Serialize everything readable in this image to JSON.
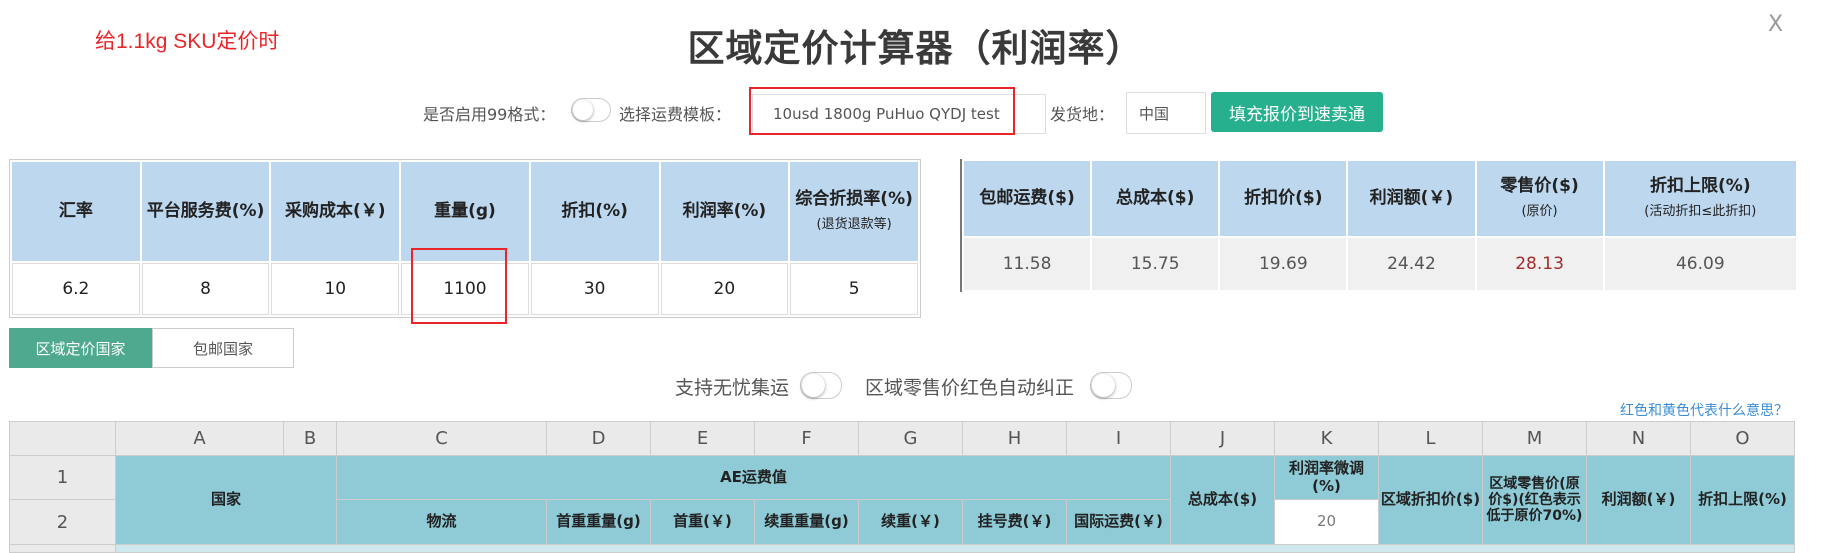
{
  "annotation": "给1.1kg SKU定价时",
  "title": "区域定价计算器（利润率）",
  "close_label": "X",
  "controls": {
    "format99_label": "是否启用99格式：",
    "template_label": "选择运费模板：",
    "template_value": "10usd 1800g PuHuo QYDJ test",
    "ship_from_label": "发货地：",
    "ship_from_value": "中国",
    "fill_button": "填充报价到速卖通"
  },
  "input_table": {
    "headers": [
      {
        "main": "汇率",
        "sub": ""
      },
      {
        "main": "平台服务费(%)",
        "sub": ""
      },
      {
        "main": "采购成本(￥)",
        "sub": ""
      },
      {
        "main": "重量(g)",
        "sub": ""
      },
      {
        "main": "折扣(%)",
        "sub": ""
      },
      {
        "main": "利润率(%)",
        "sub": ""
      },
      {
        "main": "综合折损率(%)",
        "sub": "(退货退款等)"
      }
    ],
    "values": [
      "6.2",
      "8",
      "10",
      "1100",
      "30",
      "20",
      "5"
    ]
  },
  "result_table": {
    "headers": [
      {
        "main": "包邮运费($)",
        "sub": ""
      },
      {
        "main": "总成本($)",
        "sub": ""
      },
      {
        "main": "折扣价($)",
        "sub": ""
      },
      {
        "main": "利润额(￥)",
        "sub": ""
      },
      {
        "main": "零售价($)",
        "sub": "(原价)"
      },
      {
        "main": "折扣上限(%)",
        "sub": "(活动折扣≤此折扣)"
      }
    ],
    "values": [
      "11.58",
      "15.75",
      "19.69",
      "24.42",
      "28.13",
      "46.09"
    ],
    "highlight_color": "#a52a2a"
  },
  "tabs": {
    "active": "区域定价国家",
    "inactive": "包邮国家"
  },
  "toggles": {
    "worry_free": "支持无忧集运",
    "auto_correct": "区域零售价红色自动纠正"
  },
  "help_link": "红色和黄色代表什么意思？",
  "sheet": {
    "columns": [
      "A",
      "B",
      "C",
      "D",
      "E",
      "F",
      "G",
      "H",
      "I",
      "J",
      "K",
      "L",
      "M",
      "N",
      "O"
    ],
    "rows": [
      "1",
      "2"
    ],
    "country": "国家",
    "ae_freight": "AE运费值",
    "logistics": "物流",
    "first_weight": "首重重量(g)",
    "first_cost": "首重(￥)",
    "cont_weight": "续重重量(g)",
    "cont_cost": "续重(￥)",
    "reg_fee": "挂号费(￥)",
    "intl_freight": "国际运费(￥)",
    "total_cost": "总成本($)",
    "margin_adjust": "利润率微调(%)",
    "margin_adjust_value": "20",
    "region_discount": "区域折扣价($)",
    "region_retail": "区域零售价(原价$)(红色表示低于原价70%)",
    "profit": "利润额(￥)",
    "discount_cap": "折扣上限(%)"
  },
  "colors": {
    "accent_green": "#27b08e",
    "tab_green": "#4ea98f",
    "header_blue": "#bcd7ee",
    "sheet_blue": "#8ecbd7",
    "annotation_red": "#e8262a"
  }
}
